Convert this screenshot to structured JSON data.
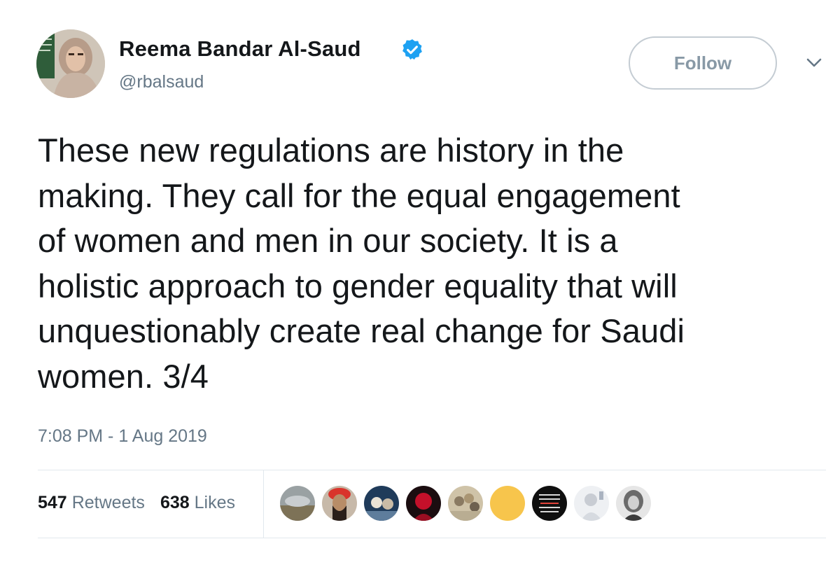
{
  "user": {
    "display_name": "Reema Bandar Al-Saud",
    "handle": "@rbalsaud",
    "verified": true
  },
  "actions": {
    "follow_label": "Follow"
  },
  "tweet": {
    "text": "These new regulations are history in the\nmaking. They call for the equal engagement\nof women and men in our society. It is a\nholistic approach to gender equality that will\nunquestionably create real change for Saudi\nwomen. 3/4",
    "timestamp": "7:08 PM - 1 Aug 2019"
  },
  "stats": {
    "retweets_count": "547",
    "retweets_label": "Retweets",
    "likes_count": "638",
    "likes_label": "Likes"
  },
  "liker_avatars": [
    {
      "icon": "avatar-landscape"
    },
    {
      "icon": "avatar-man-beard"
    },
    {
      "icon": "avatar-group"
    },
    {
      "icon": "avatar-red"
    },
    {
      "icon": "avatar-crowd"
    },
    {
      "icon": "avatar-yellow"
    },
    {
      "icon": "avatar-dark-text"
    },
    {
      "icon": "avatar-light"
    },
    {
      "icon": "avatar-woman-bw"
    }
  ],
  "colors": {
    "verified": "#1da1f2",
    "secondary_text": "#657786",
    "primary_text": "#14171a",
    "follow_border": "#c4ccd3"
  }
}
